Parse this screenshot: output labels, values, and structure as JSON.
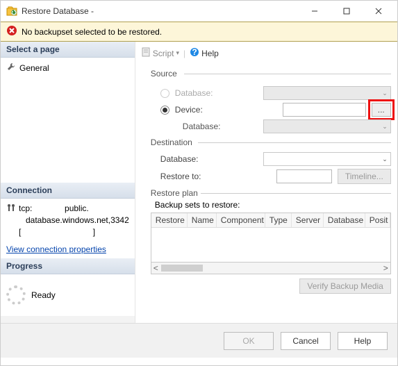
{
  "window": {
    "title": "Restore Database -"
  },
  "error": {
    "message": "No backupset selected to be restored."
  },
  "sidebar": {
    "select_page_header": "Select a page",
    "general_item": "General",
    "connection_header": "Connection",
    "conn_line1": "tcp:              public.",
    "conn_line2": "   database.windows.net,3342",
    "conn_line3": "[                               ]",
    "view_props_link": "View connection properties",
    "progress_header": "Progress",
    "progress_status": "Ready"
  },
  "toolbar": {
    "script": "Script",
    "help": "Help"
  },
  "source": {
    "legend": "Source",
    "database_label": "Database:",
    "device_label": "Device:",
    "sub_database_label": "Database:",
    "ellipsis": "..."
  },
  "destination": {
    "legend": "Destination",
    "database_label": "Database:",
    "restore_to_label": "Restore to:",
    "timeline_btn": "Timeline..."
  },
  "restore_plan": {
    "legend": "Restore plan",
    "backup_sets_label": "Backup sets to restore:",
    "columns": [
      "Restore",
      "Name",
      "Component",
      "Type",
      "Server",
      "Database",
      "Posit"
    ],
    "verify_btn": "Verify Backup Media"
  },
  "footer": {
    "ok": "OK",
    "cancel": "Cancel",
    "help": "Help"
  }
}
